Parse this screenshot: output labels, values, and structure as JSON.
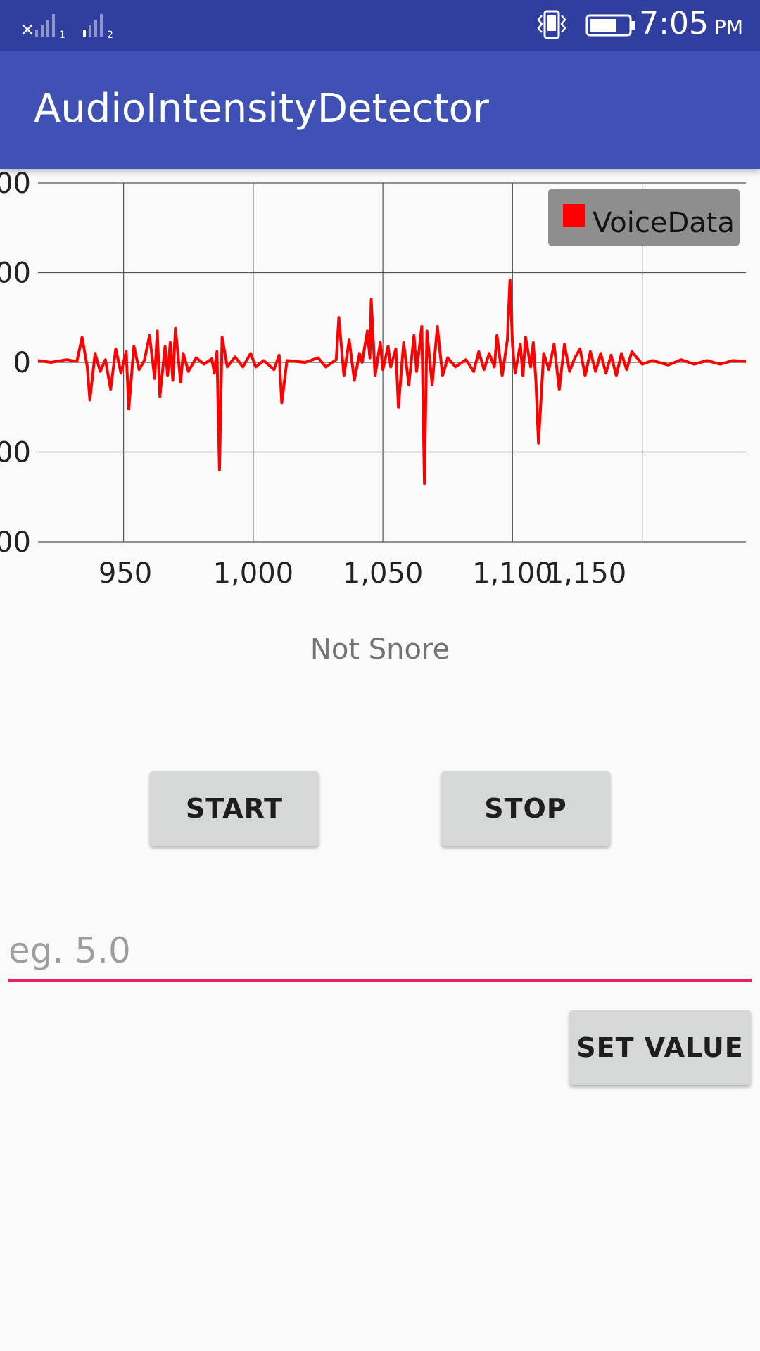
{
  "status_bar": {
    "time": "7:05",
    "ampm": "PM",
    "sim1_label": "1",
    "sim2_label": "2",
    "icons": [
      "signal-x-icon",
      "signal-icon",
      "vibrate-icon",
      "battery-icon"
    ]
  },
  "app_bar": {
    "title": "AudioIntensityDetector",
    "color": "#3f51b5"
  },
  "chart_data": {
    "type": "line",
    "title": "",
    "xlabel": "",
    "ylabel": "",
    "y_tick_labels": [
      "00",
      "00",
      "0",
      "00",
      "00"
    ],
    "x_ticks": [
      950,
      1000,
      1050,
      1100,
      1150
    ],
    "x_tick_labels": [
      "950",
      "1,000",
      "1,050",
      "1,100",
      "1,150"
    ],
    "xlim": [
      917,
      1190
    ],
    "ylim": [
      -2,
      2
    ],
    "grid": true,
    "legend_position": "top-right",
    "series": [
      {
        "name": "VoiceData",
        "color": "#ff0000",
        "points": [
          [
            917,
            0.02
          ],
          [
            922,
            0.0
          ],
          [
            928,
            0.03
          ],
          [
            932,
            0.01
          ],
          [
            934,
            0.28
          ],
          [
            936,
            -0.05
          ],
          [
            937,
            -0.42
          ],
          [
            939,
            0.1
          ],
          [
            941,
            -0.1
          ],
          [
            943,
            0.03
          ],
          [
            945,
            -0.3
          ],
          [
            947,
            0.15
          ],
          [
            949,
            -0.12
          ],
          [
            951,
            0.12
          ],
          [
            952,
            -0.52
          ],
          [
            954,
            0.18
          ],
          [
            956,
            -0.08
          ],
          [
            958,
            0.02
          ],
          [
            960,
            0.3
          ],
          [
            962,
            -0.18
          ],
          [
            963,
            0.35
          ],
          [
            964,
            -0.38
          ],
          [
            966,
            0.18
          ],
          [
            967,
            -0.15
          ],
          [
            968,
            0.22
          ],
          [
            969,
            -0.2
          ],
          [
            970,
            0.38
          ],
          [
            972,
            -0.22
          ],
          [
            973,
            0.1
          ],
          [
            975,
            -0.1
          ],
          [
            978,
            0.05
          ],
          [
            981,
            -0.02
          ],
          [
            984,
            0.04
          ],
          [
            985,
            -0.12
          ],
          [
            986,
            0.12
          ],
          [
            987,
            -1.2
          ],
          [
            988,
            0.28
          ],
          [
            990,
            -0.05
          ],
          [
            993,
            0.06
          ],
          [
            996,
            -0.05
          ],
          [
            999,
            0.1
          ],
          [
            1001,
            -0.05
          ],
          [
            1004,
            0.02
          ],
          [
            1008,
            -0.08
          ],
          [
            1010,
            0.08
          ],
          [
            1011,
            -0.45
          ],
          [
            1013,
            0.02
          ],
          [
            1020,
            0.0
          ],
          [
            1025,
            0.05
          ],
          [
            1028,
            -0.05
          ],
          [
            1032,
            0.03
          ],
          [
            1033,
            0.5
          ],
          [
            1035,
            -0.15
          ],
          [
            1037,
            0.25
          ],
          [
            1039,
            -0.2
          ],
          [
            1041,
            0.1
          ],
          [
            1042,
            0.0
          ],
          [
            1044,
            0.35
          ],
          [
            1045,
            0.05
          ],
          [
            1045.5,
            0.7
          ],
          [
            1047,
            -0.15
          ],
          [
            1049,
            0.22
          ],
          [
            1050,
            -0.08
          ],
          [
            1052,
            0.18
          ],
          [
            1053,
            -0.05
          ],
          [
            1055,
            0.15
          ],
          [
            1056,
            -0.5
          ],
          [
            1058,
            0.22
          ],
          [
            1060,
            -0.25
          ],
          [
            1062,
            0.3
          ],
          [
            1063,
            -0.1
          ],
          [
            1065,
            0.4
          ],
          [
            1066,
            -1.35
          ],
          [
            1067,
            0.35
          ],
          [
            1069,
            -0.25
          ],
          [
            1071,
            0.4
          ],
          [
            1073,
            -0.15
          ],
          [
            1075,
            0.05
          ],
          [
            1078,
            -0.05
          ],
          [
            1082,
            0.03
          ],
          [
            1085,
            -0.1
          ],
          [
            1087,
            0.12
          ],
          [
            1089,
            -0.08
          ],
          [
            1091,
            0.1
          ],
          [
            1093,
            -0.05
          ],
          [
            1094,
            0.3
          ],
          [
            1096,
            -0.15
          ],
          [
            1098,
            0.25
          ],
          [
            1099,
            0.92
          ],
          [
            1100,
            0.18
          ],
          [
            1101,
            -0.12
          ],
          [
            1103,
            0.2
          ],
          [
            1104,
            -0.15
          ],
          [
            1105,
            0.28
          ],
          [
            1107,
            -0.05
          ],
          [
            1108,
            0.22
          ],
          [
            1109,
            -0.2
          ],
          [
            1110,
            -0.9
          ],
          [
            1112,
            0.1
          ],
          [
            1114,
            -0.08
          ],
          [
            1116,
            0.2
          ],
          [
            1118,
            -0.3
          ],
          [
            1120,
            0.2
          ],
          [
            1122,
            -0.1
          ],
          [
            1124,
            0.05
          ],
          [
            1126,
            0.15
          ],
          [
            1128,
            -0.15
          ],
          [
            1130,
            0.12
          ],
          [
            1132,
            -0.1
          ],
          [
            1134,
            0.1
          ],
          [
            1136,
            -0.12
          ],
          [
            1138,
            0.08
          ],
          [
            1140,
            -0.15
          ],
          [
            1142,
            0.1
          ],
          [
            1144,
            -0.08
          ],
          [
            1146,
            0.12
          ],
          [
            1148,
            0.05
          ],
          [
            1150,
            -0.02
          ],
          [
            1154,
            0.02
          ],
          [
            1160,
            -0.03
          ],
          [
            1165,
            0.03
          ],
          [
            1170,
            -0.02
          ],
          [
            1175,
            0.02
          ],
          [
            1180,
            -0.02
          ],
          [
            1185,
            0.02
          ],
          [
            1190,
            0.01
          ]
        ]
      }
    ]
  },
  "result": {
    "label": "Not Snore"
  },
  "controls": {
    "start_label": "START",
    "stop_label": "STOP",
    "input_placeholder": "eg. 5.0",
    "input_value": "",
    "set_label": "SET VALUE",
    "accent_color": "#e91e63"
  }
}
